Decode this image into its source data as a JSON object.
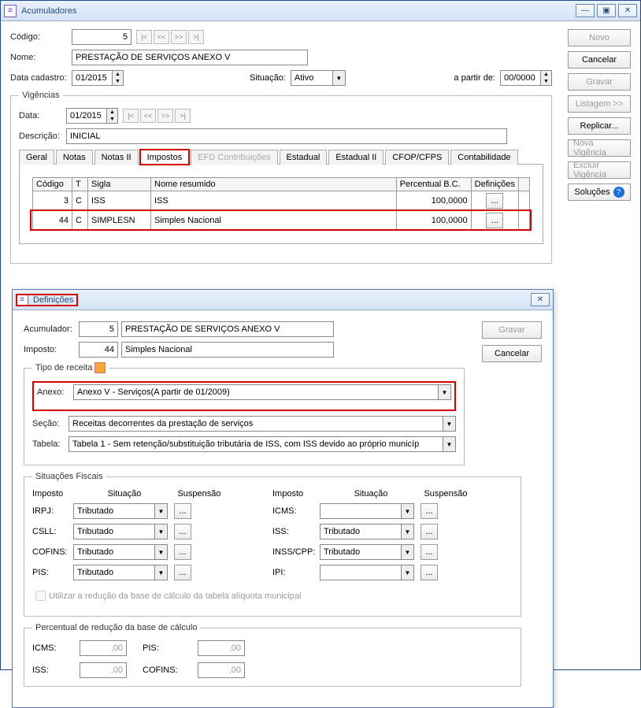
{
  "window": {
    "title": "Acumuladores",
    "winbtns": {
      "min": "—",
      "max": "▣",
      "close": "✕"
    }
  },
  "main": {
    "labels": {
      "codigo": "Código:",
      "nome": "Nome:",
      "data_cadastro": "Data cadastro:",
      "situacao": "Situação:",
      "apartir": "a partir de:"
    },
    "codigo": "5",
    "nome": "PRESTAÇÃO DE SERVIÇOS ANEXO V",
    "data_cadastro": "01/2015",
    "situacao": "Ativo",
    "apartir": "00/0000"
  },
  "sidebar": {
    "novo": "Novo",
    "cancelar": "Cancelar",
    "gravar": "Gravar",
    "listagem": "Listagem >>",
    "replicar": "Replicar...",
    "nova_vig": "Nova Vigência",
    "excluir_vig": "Excluir Vigência",
    "solucoes": "Soluções"
  },
  "vig": {
    "legend": "Vigências",
    "data_lbl": "Data:",
    "data": "01/2015",
    "desc_lbl": "Descrição:",
    "desc": "INICIAL",
    "tabs": [
      "Geral",
      "Notas",
      "Notas II",
      "Impostos",
      "EFD Contribuições",
      "Estadual",
      "Estadual II",
      "CFOP/CFPS",
      "Contabilidade"
    ],
    "tabs_active": 3,
    "tabs_disabled": 4,
    "grid": {
      "headers": [
        "Código",
        "T",
        "Sigla",
        "Nome resumido",
        "Percentual B.C.",
        "Definições"
      ],
      "rows": [
        {
          "codigo": "3",
          "t": "C",
          "sigla": "ISS",
          "nome": "ISS",
          "perc": "100,0000",
          "def": "..."
        },
        {
          "codigo": "44",
          "t": "C",
          "sigla": "SIMPLESN",
          "nome": "Simples Nacional",
          "perc": "100,0000",
          "def": "..."
        }
      ]
    }
  },
  "dlg": {
    "title": "Definições",
    "close": "✕",
    "acum_lbl": "Acumulador:",
    "acum_code": "5",
    "acum_name": "PRESTAÇÃO DE SERVIÇOS ANEXO V",
    "imp_lbl": "Imposto:",
    "imp_code": "44",
    "imp_name": "Simples Nacional",
    "gravar": "Gravar",
    "cancelar": "Cancelar",
    "tipo_receita": {
      "legend": "Tipo de receita",
      "anexo_lbl": "Anexo:",
      "anexo": "Anexo V - Serviços(A partir de 01/2009)",
      "secao_lbl": "Seção:",
      "secao": "Receitas decorrentes da prestação de serviços",
      "tabela_lbl": "Tabela:",
      "tabela": "Tabela 1 - Sem retenção/substituição tributária de ISS, com ISS devido ao próprio municíp"
    },
    "sit_fiscais": {
      "legend": "Situações Fiscais",
      "cols": [
        "Imposto",
        "Situação",
        "Suspensão",
        "Imposto",
        "Situação",
        "Suspensão"
      ],
      "left": [
        {
          "lbl": "IRPJ:",
          "val": "Tributado"
        },
        {
          "lbl": "CSLL:",
          "val": "Tributado"
        },
        {
          "lbl": "COFINS:",
          "val": "Tributado"
        },
        {
          "lbl": "PIS:",
          "val": "Tributado"
        }
      ],
      "right": [
        {
          "lbl": "ICMS:",
          "val": ""
        },
        {
          "lbl": "ISS:",
          "val": "Tributado"
        },
        {
          "lbl": "INSS/CPP:",
          "val": "Tributado"
        },
        {
          "lbl": "IPI:",
          "val": ""
        }
      ],
      "chk": "Utilizar a redução da base de cálculo da tabela alíquota municipal"
    },
    "perc_red": {
      "legend": "Percentual de redução da base de cálculo",
      "items": [
        {
          "lbl": "ICMS:",
          "val": ",00"
        },
        {
          "lbl": "PIS:",
          "val": ",00"
        },
        {
          "lbl": "ISS:",
          "val": ",00"
        },
        {
          "lbl": "COFINS:",
          "val": ",00"
        }
      ]
    }
  }
}
